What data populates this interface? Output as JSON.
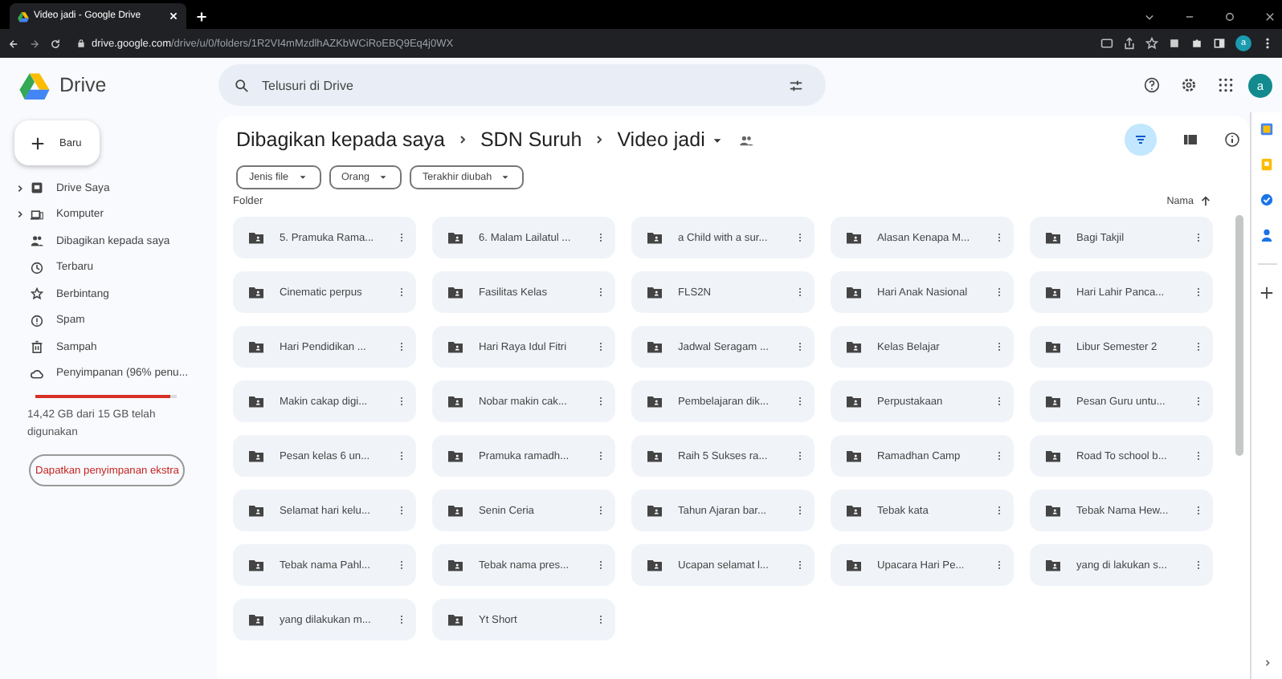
{
  "browser": {
    "tab": {
      "title": "Video jadi - Google Drive"
    },
    "url": {
      "domain": "drive.google.com",
      "path": "/drive/u/0/folders/1R2VI4mMzdlhAZKbWCiRoEBQ9Eq4j0WX"
    },
    "profile": "a"
  },
  "header": {
    "logo": "Drive",
    "search": {
      "placeholder": "Telusuri di Drive"
    },
    "avatar": "a"
  },
  "sidebar": {
    "new_button": "Baru",
    "items": [
      {
        "label": "Drive Saya",
        "kind": "drive",
        "expandable": true,
        "selected": false
      },
      {
        "label": "Komputer",
        "kind": "computer",
        "expandable": true,
        "selected": false
      },
      {
        "label": "Dibagikan kepada saya",
        "kind": "shared",
        "expandable": false,
        "selected": false
      },
      {
        "label": "Terbaru",
        "kind": "recent",
        "expandable": false,
        "selected": false
      },
      {
        "label": "Berbintang",
        "kind": "starred",
        "expandable": false,
        "selected": false
      },
      {
        "label": "Spam",
        "kind": "spam",
        "expandable": false,
        "selected": false
      },
      {
        "label": "Sampah",
        "kind": "trash",
        "expandable": false,
        "selected": false
      },
      {
        "label": "Penyimpanan (96% penu...",
        "kind": "storage",
        "expandable": false,
        "selected": false
      }
    ],
    "storage": {
      "level": 0.96,
      "text": "14,42 GB dari 15 GB telah digunakan",
      "button": "Dapatkan penyimpanan ekstra"
    }
  },
  "breadcrumb": [
    {
      "label": "Dibagikan kepada saya",
      "current": false
    },
    {
      "label": "SDN Suruh",
      "current": false
    },
    {
      "label": "Video jadi",
      "current": true
    }
  ],
  "view": {
    "filter_selected": true
  },
  "filters": [
    "Jenis file",
    "Orang",
    "Terakhir diubah"
  ],
  "section": "Folder",
  "sort": "Nama",
  "folders": [
    "5. Pramuka Rama...",
    "6. Malam Lailatul ...",
    "a Child with a sur...",
    "Alasan Kenapa M...",
    "Bagi Takjil",
    "Cinematic perpus",
    "Fasilitas Kelas",
    "FLS2N",
    "Hari Anak Nasional",
    "Hari Lahir Panca...",
    "Hari Pendidikan ...",
    "Hari Raya Idul Fitri",
    "Jadwal Seragam ...",
    "Kelas Belajar",
    "Libur Semester 2",
    "Makin cakap digi...",
    "Nobar makin cak...",
    "Pembelajaran dik...",
    "Perpustakaan",
    "Pesan Guru untu...",
    "Pesan kelas 6 un...",
    "Pramuka ramadh...",
    "Raih 5 Sukses ra...",
    "Ramadhan Camp",
    "Road To school b...",
    "Selamat hari kelu...",
    "Senin Ceria",
    "Tahun Ajaran bar...",
    "Tebak kata",
    "Tebak Nama Hew...",
    "Tebak nama Pahl...",
    "Tebak nama pres...",
    "Ucapan selamat l...",
    "Upacara Hari Pe...",
    "yang di lakukan s...",
    "yang dilakukan m...",
    "Yt Short"
  ]
}
